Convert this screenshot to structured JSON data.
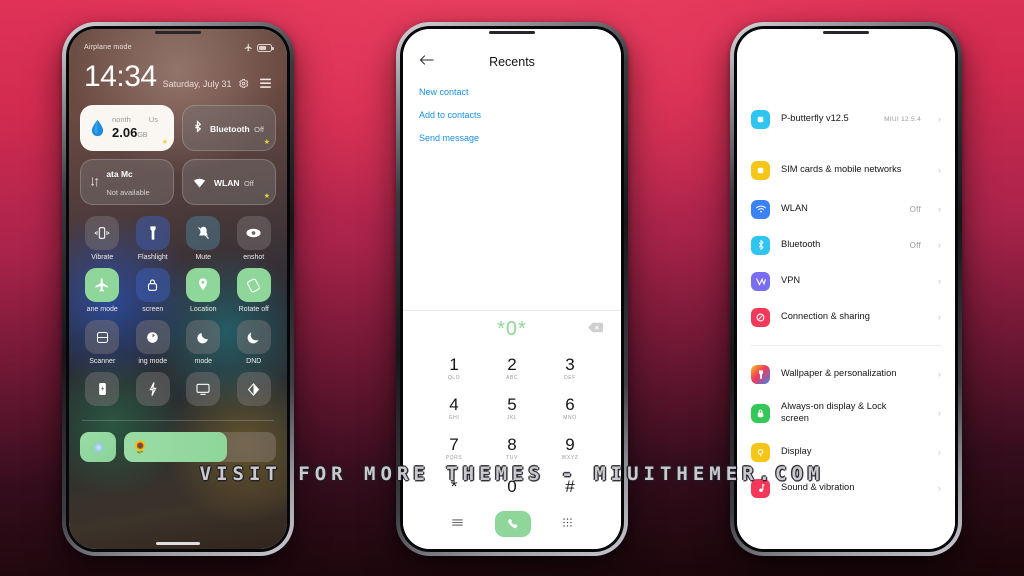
{
  "watermark": "VISIT FOR MORE THEMES - MIUITHEMER.COM",
  "theme": {
    "accent_green": "#8ed69a",
    "accent_blue": "#1a8fe3",
    "background_pink": "#e03257",
    "background_dark": "#190609"
  },
  "phone1": {
    "name": "control-center",
    "status_bar": {
      "left_text": "Airplane mode",
      "airplane_icon": "airplane-icon",
      "battery_icon": "battery-icon"
    },
    "header": {
      "time": "14:34",
      "date": "Saturday, July 31",
      "settings_icon": "gear-icon",
      "edit_icon": "menu-icon"
    },
    "big_tiles": [
      {
        "icon": "data-usage-drop-icon",
        "line1": "nonth",
        "line2": "Us",
        "amount": "2.06",
        "unit": "GB",
        "type": "data-usage",
        "starred": true
      },
      {
        "icon": "bluetooth-icon",
        "line1": "Bluetooth",
        "line2": "Off",
        "type": "toggle",
        "starred": true
      },
      {
        "icon": "mobile-data-icon",
        "line1": "ata      Mc",
        "line2": "Not available",
        "type": "toggle",
        "starred": false
      },
      {
        "icon": "wifi-icon",
        "line1": "WLAN",
        "line2": "Off",
        "type": "toggle",
        "starred": true
      }
    ],
    "tiles": [
      {
        "label": "Vibrate",
        "icon": "vibrate-icon",
        "state": "off"
      },
      {
        "label": "Flashlight",
        "icon": "flashlight-icon",
        "state": "blue"
      },
      {
        "label": "Mute",
        "icon": "mute-bell-icon",
        "state": "tealish"
      },
      {
        "label": "enshot",
        "icon": "eye-icon",
        "state": "off"
      },
      {
        "label": "ane mode",
        "icon": "airplane-icon",
        "state": "on"
      },
      {
        "label": "screen",
        "icon": "lock-icon",
        "state": "blue"
      },
      {
        "label": "Location",
        "icon": "location-pin-icon",
        "state": "on"
      },
      {
        "label": "Rotate off",
        "icon": "rotate-icon",
        "state": "on"
      },
      {
        "label": "Scanner",
        "icon": "scanner-icon",
        "state": "off"
      },
      {
        "label": "ing mode",
        "icon": "reading-mode-icon",
        "state": "off"
      },
      {
        "label": "mode",
        "icon": "dark-mode-icon",
        "state": "off"
      },
      {
        "label": "DND",
        "icon": "moon-icon",
        "state": "off"
      },
      {
        "label": "",
        "icon": "battery-saver-icon",
        "state": "off"
      },
      {
        "label": "",
        "icon": "lightning-icon",
        "state": "off"
      },
      {
        "label": "",
        "icon": "cast-screen-icon",
        "state": "off"
      },
      {
        "label": "",
        "icon": "contrast-icon",
        "state": "off"
      }
    ],
    "bottom": {
      "brightness_icon": "brightness-dot-icon",
      "volume_icon": "sun-flower-icon"
    }
  },
  "phone2": {
    "name": "dialer-recents",
    "header": {
      "title": "Recents",
      "back_icon": "back-arrow-icon"
    },
    "links": [
      {
        "label": "New contact"
      },
      {
        "label": "Add to contacts"
      },
      {
        "label": "Send message"
      }
    ],
    "display": {
      "number": "*0*",
      "delete_icon": "backspace-icon"
    },
    "keys": [
      {
        "digit": "1",
        "letters": "QLO"
      },
      {
        "digit": "2",
        "letters": "ABC"
      },
      {
        "digit": "3",
        "letters": "DEF"
      },
      {
        "digit": "4",
        "letters": "GHI"
      },
      {
        "digit": "5",
        "letters": "JKL"
      },
      {
        "digit": "6",
        "letters": "MNO"
      },
      {
        "digit": "7",
        "letters": "PQRS"
      },
      {
        "digit": "8",
        "letters": "TUV"
      },
      {
        "digit": "9",
        "letters": "WXYZ"
      },
      {
        "digit": "*",
        "letters": ""
      },
      {
        "digit": "0",
        "letters": ""
      },
      {
        "digit": "#",
        "letters": ""
      }
    ],
    "actions": {
      "menu_icon": "hamburger-icon",
      "call_icon": "phone-call-icon",
      "keypad_icon": "keypad-icon"
    }
  },
  "phone3": {
    "name": "settings-list",
    "groups": [
      {
        "rows": [
          {
            "label": "P-butterfly v12.5",
            "value": "MIUI 12.5.4",
            "icon": "about-phone-icon",
            "color": "#2ec6f0",
            "value_size": "small"
          }
        ]
      },
      {
        "rows": [
          {
            "label": "SIM cards & mobile networks",
            "value": "",
            "icon": "sim-card-icon",
            "color": "#f5c518",
            "tall": true
          },
          {
            "label": "WLAN",
            "value": "Off",
            "icon": "wifi-icon",
            "color": "#3b82f6"
          },
          {
            "label": "Bluetooth",
            "value": "Off",
            "icon": "bluetooth-icon",
            "color": "#2ec6f0"
          },
          {
            "label": "VPN",
            "value": "",
            "icon": "vpn-icon",
            "color": "#7a6ef0"
          },
          {
            "label": "Connection & sharing",
            "value": "",
            "icon": "connection-sharing-icon",
            "color": "#f2395a"
          }
        ]
      },
      {
        "rows": [
          {
            "label": "Wallpaper & personalization",
            "value": "",
            "icon": "wallpaper-icon",
            "color": "#e8457a"
          },
          {
            "label": "Always-on display & Lock screen",
            "value": "",
            "icon": "lock-screen-icon",
            "color": "#35c759",
            "tall": true
          },
          {
            "label": "Display",
            "value": "",
            "icon": "display-icon",
            "color": "#f5c518"
          },
          {
            "label": "Sound & vibration",
            "value": "",
            "icon": "sound-vibration-icon",
            "color": "#f2395a"
          }
        ]
      }
    ]
  }
}
